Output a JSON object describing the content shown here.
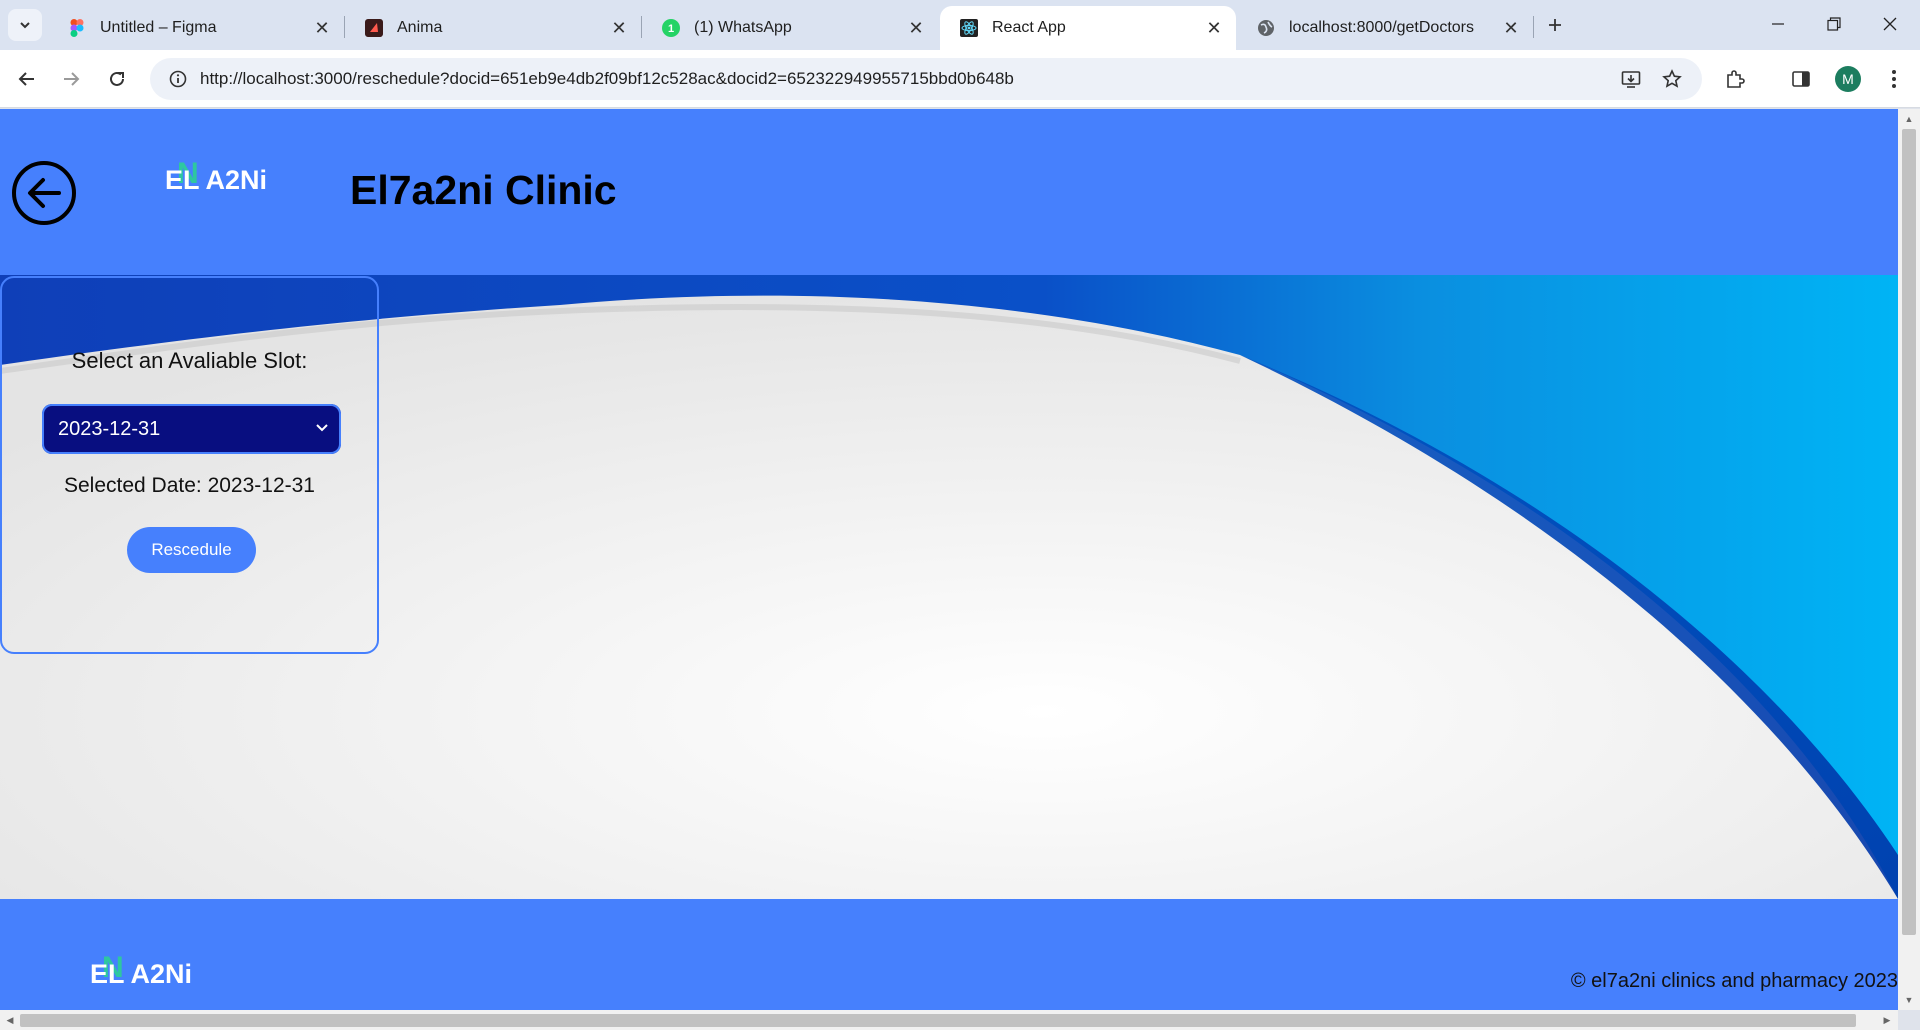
{
  "browser": {
    "tabs": [
      {
        "title": "Untitled – Figma",
        "icon": "figma-icon",
        "active": false
      },
      {
        "title": "Anima",
        "icon": "anima-icon",
        "active": false
      },
      {
        "title": "(1) WhatsApp",
        "icon": "whatsapp-icon",
        "active": false
      },
      {
        "title": "React App",
        "icon": "react-icon",
        "active": true
      },
      {
        "title": "localhost:8000/getDoctors",
        "icon": "globe-icon",
        "active": false
      }
    ],
    "url": "http://localhost:3000/reschedule?docid=651eb9e4db2f09bf12c528ac&docid2=652322949955715bbd0b648b",
    "profile_initial": "M"
  },
  "header": {
    "logo_text": "EL A2Ni",
    "logo_mark": "N",
    "title": "El7a2ni Clinic"
  },
  "slot_card": {
    "prompt": "Select an Avaliable Slot:",
    "selected_option": "2023-12-31",
    "selected_date_text": "Selected Date: 2023-12-31",
    "button_label": "Rescedule"
  },
  "footer": {
    "logo_text": "EL A2Ni",
    "logo_mark": "N",
    "copyright": "© el7a2ni clinics and pharmacy 2023"
  },
  "colors": {
    "brand_blue": "#4680fd",
    "select_bg": "#080e80",
    "logo_accent": "#2ec7a0"
  }
}
